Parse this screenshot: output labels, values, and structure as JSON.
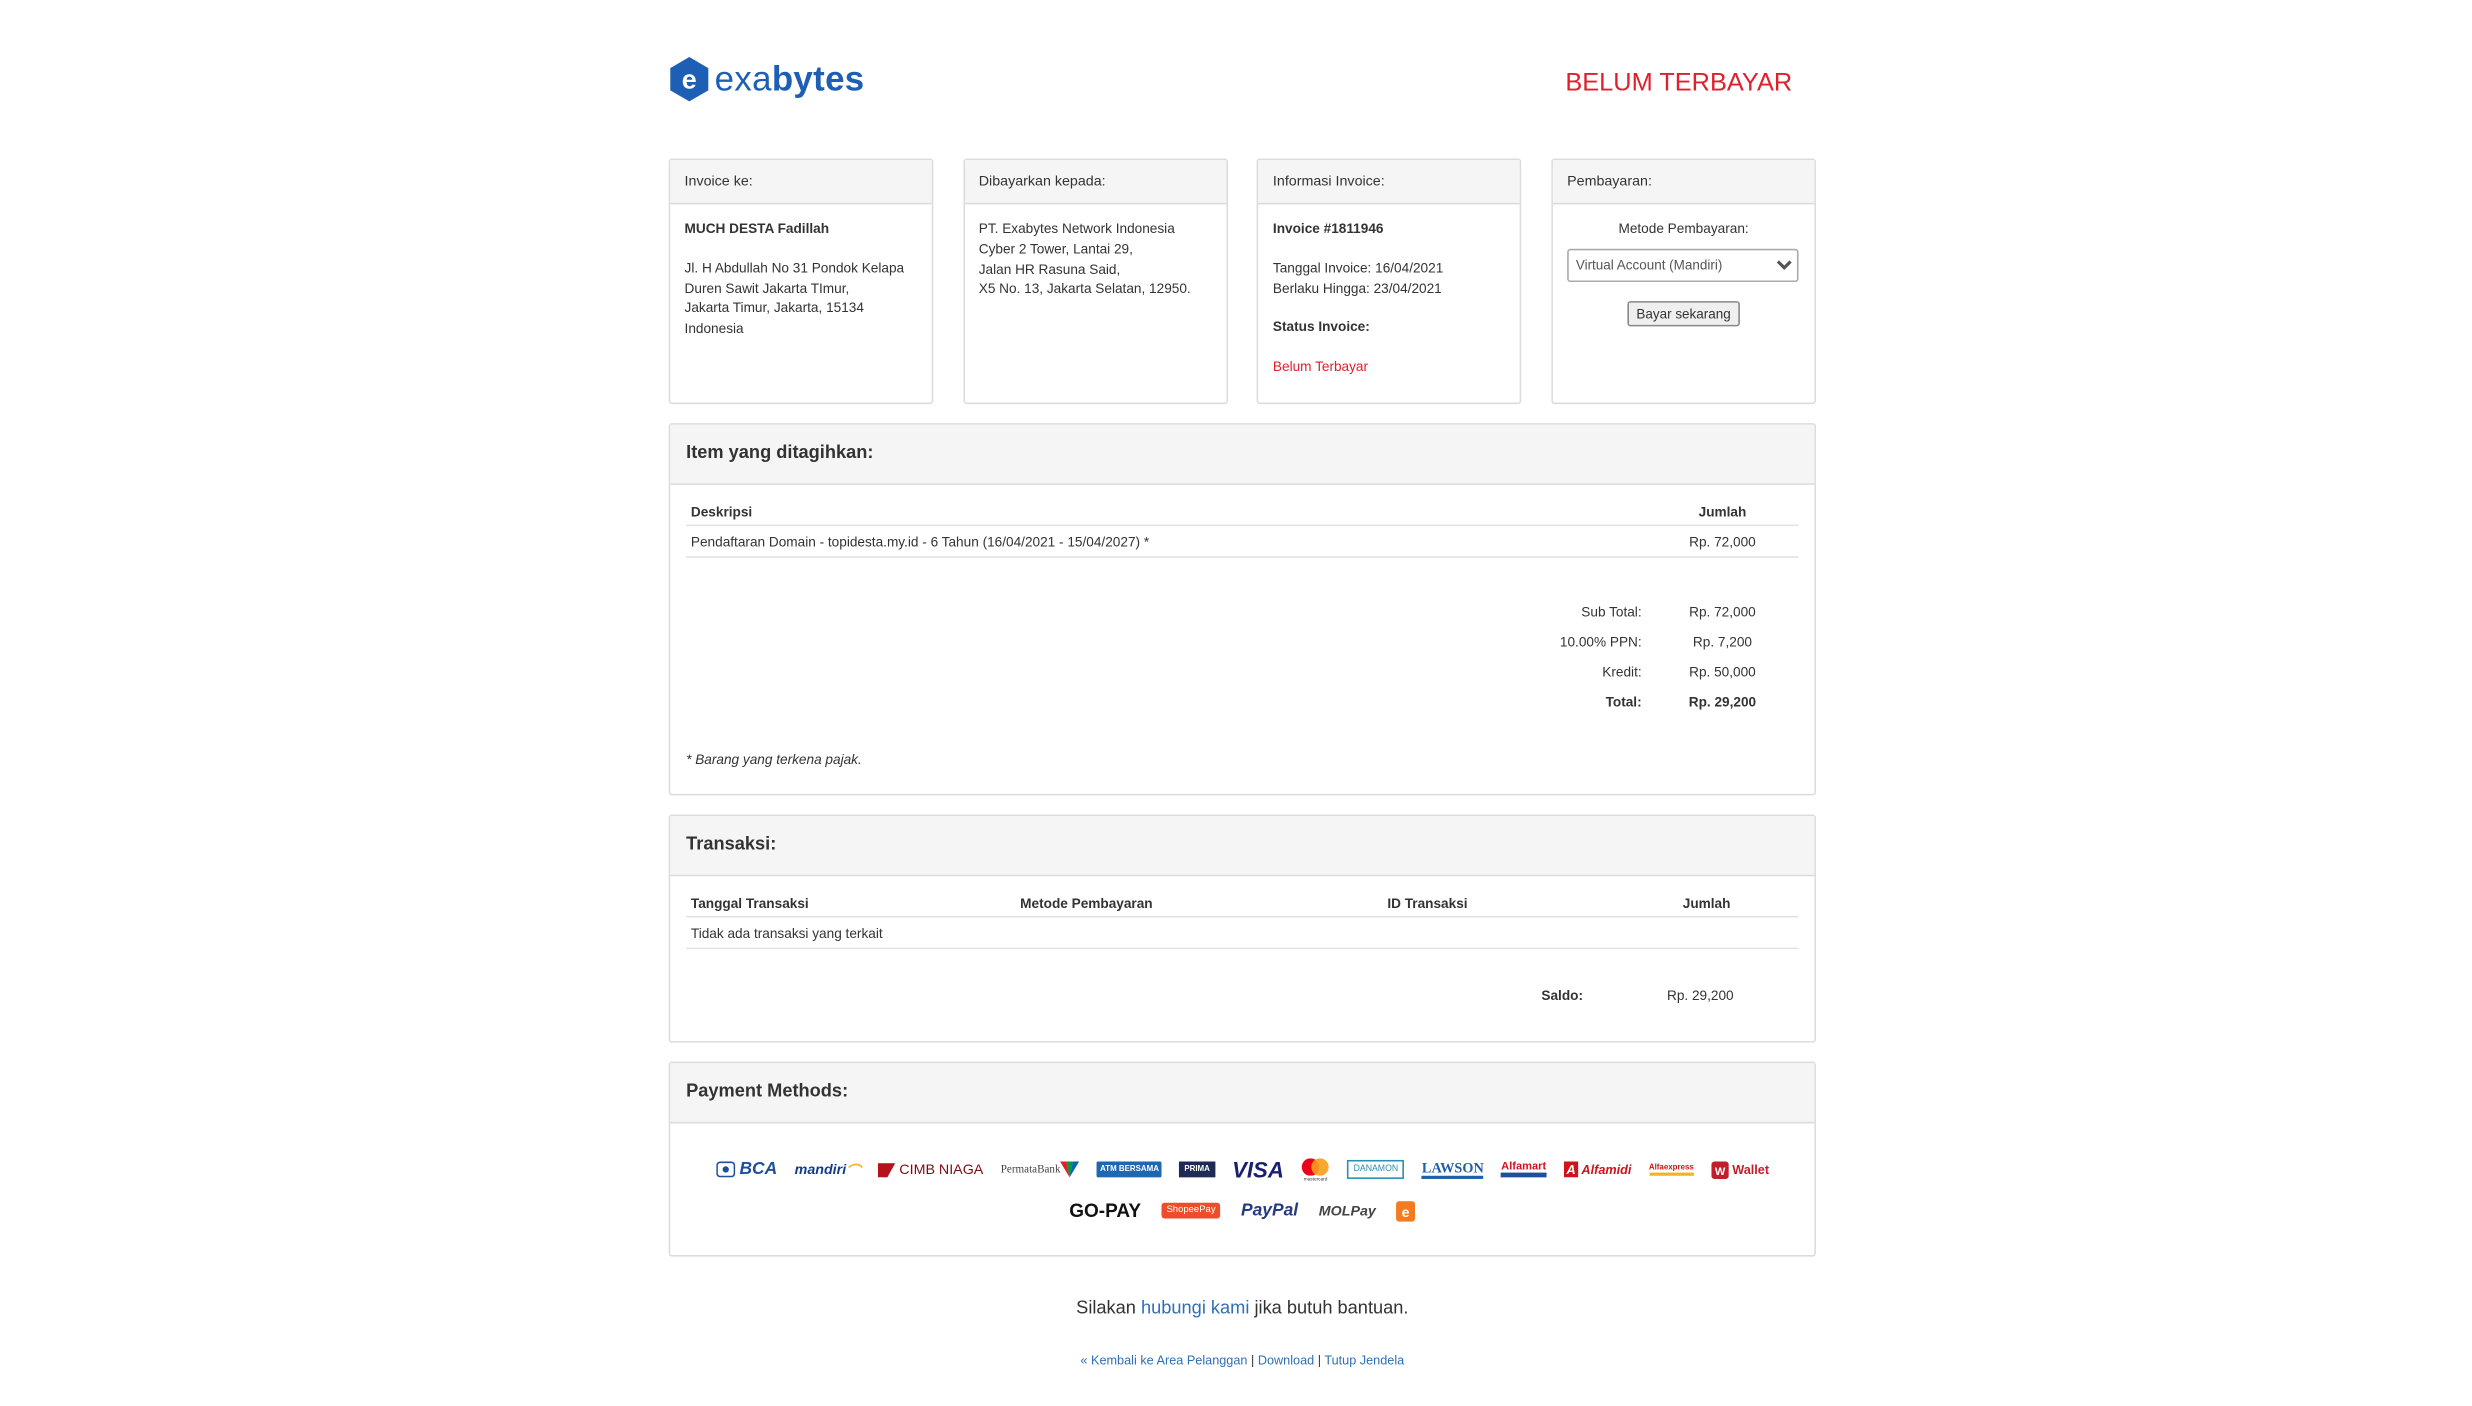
{
  "brand": {
    "logo_letter": "e",
    "name_light": "exa",
    "name_bold": "bytes",
    "color": "#1d5fb4"
  },
  "status_heading": "BELUM TERBAYAR",
  "invoice_to": {
    "title": "Invoice ke:",
    "name": "MUCH DESTA Fadillah",
    "address": [
      "Jl. H Abdullah No 31 Pondok Kelapa",
      "Duren Sawit Jakarta TImur,",
      "Jakarta Timur, Jakarta, 15134",
      "Indonesia"
    ]
  },
  "pay_to": {
    "title": "Dibayarkan kepada:",
    "lines": [
      "PT. Exabytes Network Indonesia",
      "Cyber 2 Tower, Lantai 29,",
      "Jalan HR Rasuna Said,",
      "X5 No. 13, Jakarta Selatan, 12950."
    ]
  },
  "invoice_info": {
    "title": "Informasi Invoice:",
    "number": "Invoice #1811946",
    "date": "Tanggal Invoice: 16/04/2021",
    "due": "Berlaku Hingga: 23/04/2021",
    "status_label": "Status Invoice:",
    "status_value": "Belum Terbayar"
  },
  "payment": {
    "title": "Pembayaran:",
    "method_label": "Metode Pembayaran:",
    "selected": "Virtual Account (Mandiri)",
    "button": "Bayar sekarang"
  },
  "items": {
    "title": "Item yang ditagihkan:",
    "col_desc": "Deskripsi",
    "col_amount": "Jumlah",
    "rows": [
      {
        "desc": "Pendaftaran Domain - topidesta.my.id - 6 Tahun (16/04/2021 - 15/04/2027) *",
        "amount": "Rp. 72,000"
      }
    ],
    "subtotal_label": "Sub Total:",
    "subtotal": "Rp. 72,000",
    "tax_label": "10.00% PPN:",
    "tax": "Rp. 7,200",
    "credit_label": "Kredit:",
    "credit": "Rp. 50,000",
    "total_label": "Total:",
    "total": "Rp. 29,200",
    "note": "* Barang yang terkena pajak."
  },
  "transactions": {
    "title": "Transaksi:",
    "col_date": "Tanggal Transaksi",
    "col_method": "Metode Pembayaran",
    "col_id": "ID Transaksi",
    "col_amount": "Jumlah",
    "empty": "Tidak ada transaksi yang terkait",
    "balance_label": "Saldo:",
    "balance": "Rp. 29,200"
  },
  "payment_methods": {
    "title": "Payment Methods:",
    "row1": [
      "BCA",
      "mandiri",
      "CIMB NIAGA",
      "PermataBank",
      "ATM BERSAMA",
      "PRIMA",
      "VISA",
      "mastercard",
      "DANAMON",
      "LAWSON",
      "Alfamart",
      "Alfamidi",
      "Alfaexpress",
      "Wallet"
    ],
    "row2": [
      "GO-PAY",
      "ShopeePay",
      "PayPal",
      "MOLPay",
      "Exabytes Pay"
    ]
  },
  "footer": {
    "help_before": "Silakan ",
    "help_link": "hubungi kami",
    "help_after": " jika butuh bantuan.",
    "back_link": "« Kembali ke Area Pelanggan",
    "sep": "|",
    "download_link": "Download",
    "close_link": "Tutup Jendela"
  }
}
